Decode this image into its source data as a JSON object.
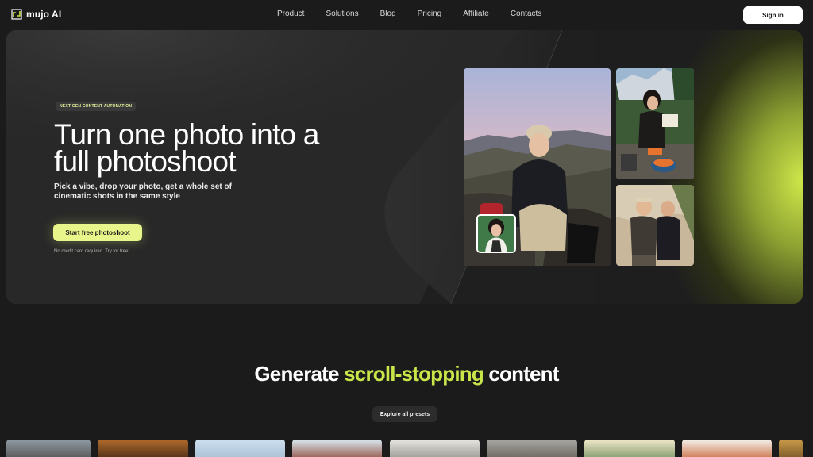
{
  "nav": {
    "logo_text": "mujo AI",
    "links": [
      "Product",
      "Solutions",
      "Blog",
      "Pricing",
      "Affiliate",
      "Contacts"
    ],
    "signin_label": "Sign in"
  },
  "hero": {
    "badge": "NEXT GEN CONTENT AUTOMATION",
    "title": "Turn one photo into a full photoshoot",
    "subtitle": "Pick a vibe, drop your photo, get a whole set of cinematic shots in the same style",
    "cta_label": "Start free photoshoot",
    "note": "No credit card required. Try for free!"
  },
  "section": {
    "title_before": "Generate ",
    "title_accent": "scroll-stopping",
    "title_after": " content",
    "explore_label": "Explore all presets"
  },
  "colors": {
    "accent_lime": "#c8e64a",
    "cta_bg": "#e8f58a",
    "background": "#1b1b1b",
    "hero_bg": "#282828"
  },
  "icons": {
    "logo": "mujo-logo-icon"
  }
}
